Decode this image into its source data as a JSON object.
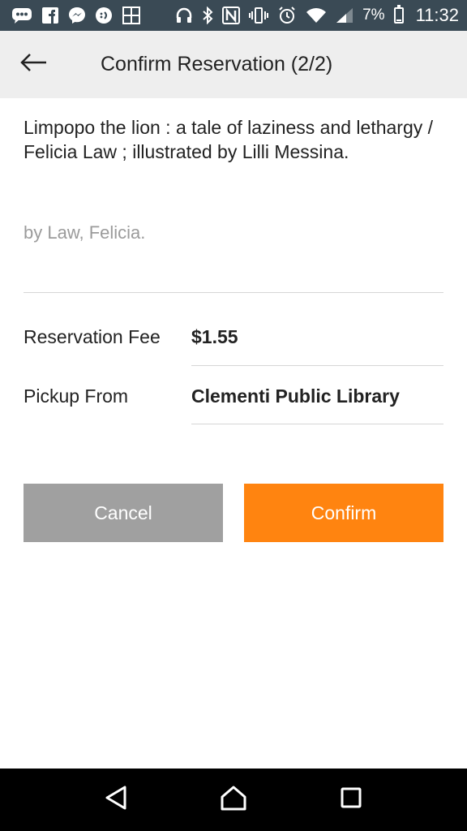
{
  "status_bar": {
    "battery_percent": "7%",
    "time": "11:32",
    "left_icons": [
      "chat-bubble-icon",
      "facebook-icon",
      "messenger-icon",
      "face-icon",
      "uniqlo-icon"
    ],
    "right_icons": [
      "headphones-icon",
      "bluetooth-icon",
      "nfc-icon",
      "vibrate-icon",
      "alarm-icon",
      "wifi-icon",
      "signal-icon",
      "battery-icon"
    ],
    "background": "#3a4a55"
  },
  "app_bar": {
    "title": "Confirm Reservation (2/2)",
    "back_icon": "arrow-left-icon"
  },
  "book": {
    "title": "Limpopo the lion : a tale of laziness and lethargy / Felicia Law ; illustrated by Lilli Messina.",
    "author": "by Law, Felicia."
  },
  "details": {
    "fee_label": "Reservation Fee",
    "fee_value": "$1.55",
    "pickup_label": "Pickup From",
    "pickup_value": "Clementi Public Library"
  },
  "actions": {
    "cancel_label": "Cancel",
    "confirm_label": "Confirm",
    "cancel_color": "#a0a0a0",
    "confirm_color": "#ff8410"
  },
  "nav_bar": {
    "icons": [
      "back-triangle-icon",
      "home-icon",
      "recents-icon"
    ]
  }
}
